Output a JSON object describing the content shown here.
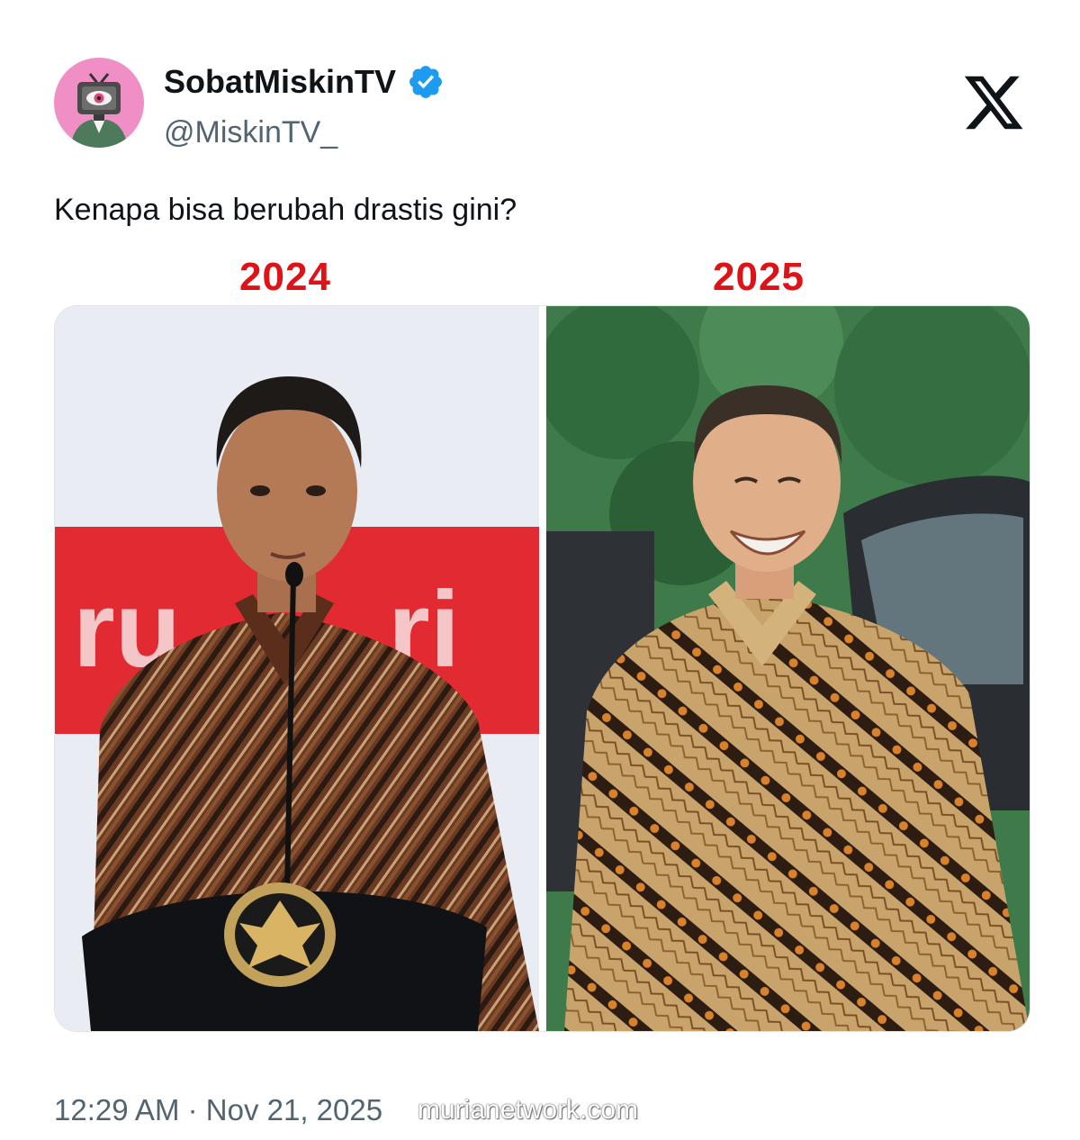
{
  "account": {
    "display_name": "SobatMiskinTV",
    "handle": "@MiskinTV_",
    "verified_icon": "verified-badge-icon",
    "avatar_icon": "tv-eye-avatar",
    "platform_logo": "x-logo-icon"
  },
  "tweet": {
    "text": "Kenapa bisa berubah drastis gini?",
    "timestamp": "12:29 AM · Nov 21, 2025"
  },
  "media": {
    "left_label": "2024",
    "right_label": "2025",
    "left_photo": "man-at-podium-photo",
    "right_photo": "man-smiling-outdoors-photo"
  },
  "overlay": {
    "watermark": "murianetwork.com"
  },
  "colors": {
    "accent_red": "#dd1318",
    "verified_blue": "#1d9bf0",
    "secondary_text": "#536471",
    "avatar_pink": "#f08fc6"
  }
}
